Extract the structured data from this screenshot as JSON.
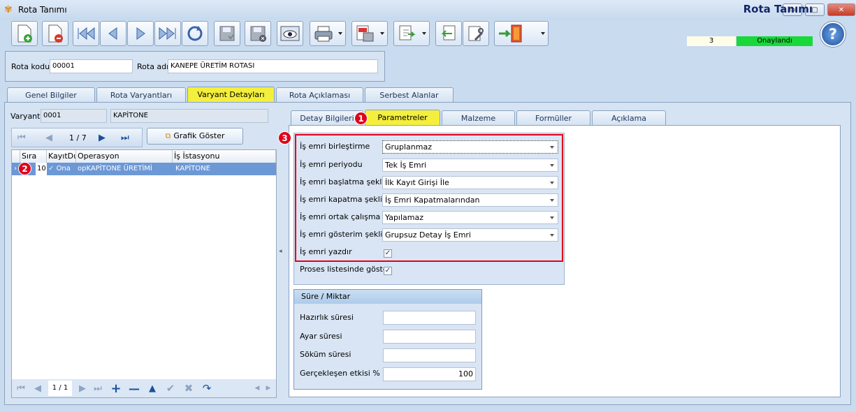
{
  "window": {
    "title": "Rota Tanımı",
    "controls": [
      "▭",
      "▢",
      "✕"
    ]
  },
  "header": {
    "title": "Rota Tanımı",
    "record_count": "3",
    "status": "Onaylandı",
    "help_icon": "?"
  },
  "form": {
    "rota_kodu_label": "Rota kodu",
    "rota_kodu_value": "00001",
    "rota_adi_label": "Rota adı",
    "rota_adi_value": "KANEPE ÜRETİM ROTASI"
  },
  "main_tabs": [
    "Genel Bilgiler",
    "Rota Varyantları",
    "Varyant Detayları",
    "Rota Açıklaması",
    "Serbest Alanlar"
  ],
  "variant": {
    "label": "Varyant",
    "code": "0001",
    "name": "KAPİTONE"
  },
  "pager": {
    "text": "1 / 7",
    "graph_button": "Grafik Göster"
  },
  "grid": {
    "columns": [
      "Sıra",
      "KayıtDurumu",
      "Operasyon",
      "İş İstasyonu"
    ],
    "col_display": [
      "Sıra",
      "KayıtDu",
      "Operasyon",
      "İş İstasyonu"
    ],
    "row": {
      "sira": "10",
      "durum": "Ona",
      "operasyon": "opKAPİTONE ÜRETİMİ",
      "istasyon": "KAPİTONE"
    },
    "nav_text": "1 / 1"
  },
  "detail_tabs": [
    "Detay Bilgileri",
    "Parametreler",
    "Malzeme",
    "Formüller",
    "Açıklama"
  ],
  "params": [
    {
      "label": "İş emri birleştirme",
      "value": "Gruplanmaz"
    },
    {
      "label": "İş emri periyodu",
      "value": "Tek İş Emri"
    },
    {
      "label": "İş emri başlatma şekli",
      "value": "İlk Kayıt Girişi İle"
    },
    {
      "label": "İş emri kapatma şekli",
      "value": "İş Emri Kapatmalarından"
    },
    {
      "label": "İş emri ortak çalışma",
      "value": "Yapılamaz"
    },
    {
      "label": "İş emri gösterim şekli",
      "value": "Grupsuz Detay İş Emri"
    }
  ],
  "checks": [
    {
      "label": "İş emri yazdır",
      "checked": true
    },
    {
      "label": "Proses listesinde göster",
      "checked": true
    }
  ],
  "sure": {
    "title": "Süre / Miktar",
    "fields": [
      {
        "label": "Hazırlık süresi",
        "value": ""
      },
      {
        "label": "Ayar süresi",
        "value": ""
      },
      {
        "label": "Söküm süresi",
        "value": ""
      },
      {
        "label": "Gerçekleşen etkisi %",
        "value": "100"
      }
    ]
  },
  "badges": [
    "1",
    "2",
    "3"
  ],
  "colors": {
    "active_tab": "#f4ef3c",
    "status_green": "#19d83a",
    "highlight_red": "#e1001a",
    "selection_blue": "#6d98d6"
  }
}
